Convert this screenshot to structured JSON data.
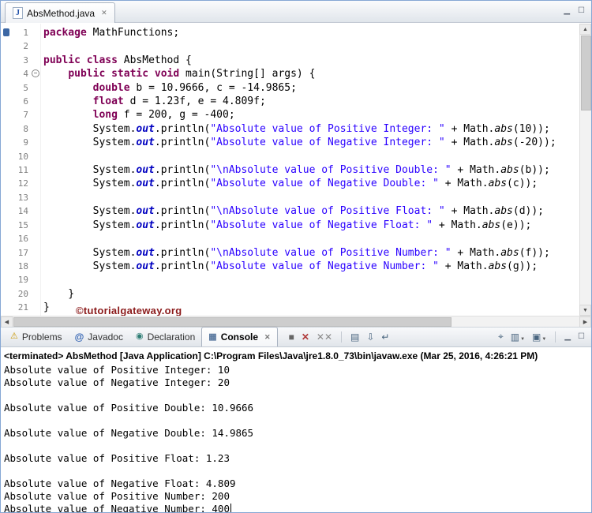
{
  "icons": {
    "java_file": "J",
    "close": "✕",
    "minimize": "▁",
    "maximize": "☐",
    "scroll_up": "▲",
    "scroll_down": "▼",
    "scroll_left": "◀",
    "scroll_right": "▶",
    "problems": "⚠",
    "javadoc": "@",
    "declaration": "◉",
    "console": "▦",
    "terminate": "■",
    "remove_launch": "✕",
    "remove_all": "✕✕",
    "clear": "▤",
    "scroll_lock": "⇩",
    "word_wrap": "↵",
    "pin": "⌖",
    "display_console": "▥",
    "open_console": "▣",
    "dropdown": "▼"
  },
  "colors": {
    "keyword": "#7f0055",
    "string": "#2a00ff",
    "static_field": "#0000c0",
    "watermark": "#8b1a1a"
  },
  "editor": {
    "tab": {
      "title": "AbsMethod.java"
    },
    "watermark": "©tutorialgateway.org",
    "lines": [
      {
        "n": 1,
        "tokens": [
          [
            "kw",
            "package"
          ],
          [
            "pl",
            " MathFunctions;"
          ]
        ]
      },
      {
        "n": 2,
        "tokens": []
      },
      {
        "n": 3,
        "tokens": [
          [
            "kw",
            "public"
          ],
          [
            "pl",
            " "
          ],
          [
            "kw",
            "class"
          ],
          [
            "pl",
            " AbsMethod {"
          ]
        ]
      },
      {
        "n": 4,
        "fold": true,
        "tokens": [
          [
            "pl",
            "    "
          ],
          [
            "kw",
            "public"
          ],
          [
            "pl",
            " "
          ],
          [
            "kw",
            "static"
          ],
          [
            "pl",
            " "
          ],
          [
            "kw",
            "void"
          ],
          [
            "pl",
            " main(String[] args) {"
          ]
        ]
      },
      {
        "n": 5,
        "tokens": [
          [
            "pl",
            "        "
          ],
          [
            "kw",
            "double"
          ],
          [
            "pl",
            " b = 10.9666, c = -14.9865;"
          ]
        ]
      },
      {
        "n": 6,
        "tokens": [
          [
            "pl",
            "        "
          ],
          [
            "kw",
            "float"
          ],
          [
            "pl",
            " d = 1.23f, e = 4.809f;"
          ]
        ]
      },
      {
        "n": 7,
        "tokens": [
          [
            "pl",
            "        "
          ],
          [
            "kw",
            "long"
          ],
          [
            "pl",
            " f = 200, g = -400;"
          ]
        ]
      },
      {
        "n": 8,
        "tokens": [
          [
            "pl",
            "        System."
          ],
          [
            "fld",
            "out"
          ],
          [
            "pl",
            ".println("
          ],
          [
            "st",
            "\"Absolute value of Positive Integer: \""
          ],
          [
            "pl",
            " + Math."
          ],
          [
            "sm",
            "abs"
          ],
          [
            "pl",
            "(10));"
          ]
        ]
      },
      {
        "n": 9,
        "tokens": [
          [
            "pl",
            "        System."
          ],
          [
            "fld",
            "out"
          ],
          [
            "pl",
            ".println("
          ],
          [
            "st",
            "\"Absolute value of Negative Integer: \""
          ],
          [
            "pl",
            " + Math."
          ],
          [
            "sm",
            "abs"
          ],
          [
            "pl",
            "(-20));"
          ]
        ]
      },
      {
        "n": 10,
        "tokens": []
      },
      {
        "n": 11,
        "tokens": [
          [
            "pl",
            "        System."
          ],
          [
            "fld",
            "out"
          ],
          [
            "pl",
            ".println("
          ],
          [
            "st",
            "\"\\nAbsolute value of Positive Double: \""
          ],
          [
            "pl",
            " + Math."
          ],
          [
            "sm",
            "abs"
          ],
          [
            "pl",
            "(b));"
          ]
        ]
      },
      {
        "n": 12,
        "tokens": [
          [
            "pl",
            "        System."
          ],
          [
            "fld",
            "out"
          ],
          [
            "pl",
            ".println("
          ],
          [
            "st",
            "\"Absolute value of Negative Double: \""
          ],
          [
            "pl",
            " + Math."
          ],
          [
            "sm",
            "abs"
          ],
          [
            "pl",
            "(c));"
          ]
        ]
      },
      {
        "n": 13,
        "tokens": []
      },
      {
        "n": 14,
        "tokens": [
          [
            "pl",
            "        System."
          ],
          [
            "fld",
            "out"
          ],
          [
            "pl",
            ".println("
          ],
          [
            "st",
            "\"\\nAbsolute value of Positive Float: \""
          ],
          [
            "pl",
            " + Math."
          ],
          [
            "sm",
            "abs"
          ],
          [
            "pl",
            "(d));"
          ]
        ]
      },
      {
        "n": 15,
        "tokens": [
          [
            "pl",
            "        System."
          ],
          [
            "fld",
            "out"
          ],
          [
            "pl",
            ".println("
          ],
          [
            "st",
            "\"Absolute value of Negative Float: \""
          ],
          [
            "pl",
            " + Math."
          ],
          [
            "sm",
            "abs"
          ],
          [
            "pl",
            "(e));"
          ]
        ]
      },
      {
        "n": 16,
        "tokens": []
      },
      {
        "n": 17,
        "tokens": [
          [
            "pl",
            "        System."
          ],
          [
            "fld",
            "out"
          ],
          [
            "pl",
            ".println("
          ],
          [
            "st",
            "\"\\nAbsolute value of Positive Number: \""
          ],
          [
            "pl",
            " + Math."
          ],
          [
            "sm",
            "abs"
          ],
          [
            "pl",
            "(f));"
          ]
        ]
      },
      {
        "n": 18,
        "tokens": [
          [
            "pl",
            "        System."
          ],
          [
            "fld",
            "out"
          ],
          [
            "pl",
            ".println("
          ],
          [
            "st",
            "\"Absolute value of Negative Number: \""
          ],
          [
            "pl",
            " + Math."
          ],
          [
            "sm",
            "abs"
          ],
          [
            "pl",
            "(g));"
          ]
        ]
      },
      {
        "n": 19,
        "tokens": []
      },
      {
        "n": 20,
        "tokens": [
          [
            "pl",
            "    }"
          ]
        ]
      },
      {
        "n": 21,
        "tokens": [
          [
            "pl",
            "}"
          ]
        ]
      }
    ]
  },
  "console": {
    "tabs": [
      {
        "label": "Problems"
      },
      {
        "label": "Javadoc"
      },
      {
        "label": "Declaration"
      },
      {
        "label": "Console",
        "active": true
      }
    ],
    "status_line": "<terminated> AbsMethod [Java Application] C:\\Program Files\\Java\\jre1.8.0_73\\bin\\javaw.exe (Mar 25, 2016, 4:26:21 PM)",
    "output": [
      "Absolute value of Positive Integer: 10",
      "Absolute value of Negative Integer: 20",
      "",
      "Absolute value of Positive Double: 10.9666",
      "",
      "Absolute value of Negative Double: 14.9865",
      "",
      "Absolute value of Positive Float: 1.23",
      "",
      "Absolute value of Negative Float: 4.809",
      "Absolute value of Positive Number: 200",
      "Absolute value of Negative Number: 400"
    ]
  }
}
